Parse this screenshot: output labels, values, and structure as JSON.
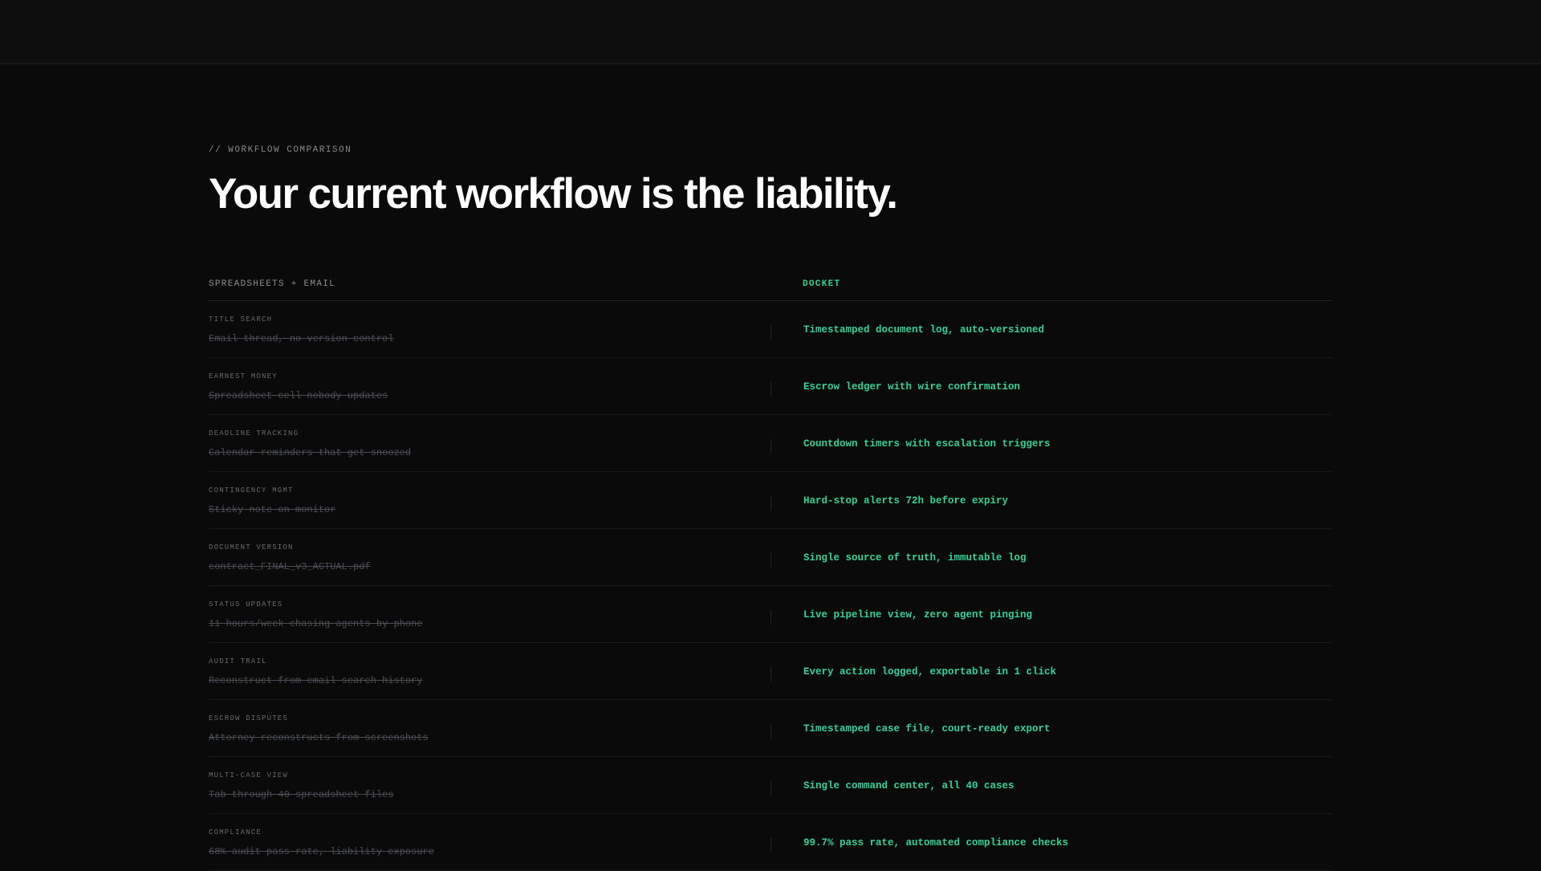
{
  "section": {
    "eyebrow": "// WORKFLOW COMPARISON",
    "headline": "Your current workflow is the liability."
  },
  "columns": {
    "left": "SPREADSHEETS + EMAIL",
    "right": "DOCKET"
  },
  "colors": {
    "background": "#0a0a0a",
    "accent": "#34d399",
    "muted": "#4a4e55"
  },
  "rows": [
    {
      "label": "TITLE SEARCH",
      "old": "Email thread, no version control",
      "new": "Timestamped document log, auto-versioned"
    },
    {
      "label": "EARNEST MONEY",
      "old": "Spreadsheet cell nobody updates",
      "new": "Escrow ledger with wire confirmation"
    },
    {
      "label": "DEADLINE TRACKING",
      "old": "Calendar reminders that get snoozed",
      "new": "Countdown timers with escalation triggers"
    },
    {
      "label": "CONTINGENCY MGMT",
      "old": "Sticky note on monitor",
      "new": "Hard-stop alerts 72h before expiry"
    },
    {
      "label": "DOCUMENT VERSION",
      "old": "contract_FINAL_v3_ACTUAL.pdf",
      "new": "Single source of truth, immutable log"
    },
    {
      "label": "STATUS UPDATES",
      "old": "11 hours/week chasing agents by phone",
      "new": "Live pipeline view, zero agent pinging"
    },
    {
      "label": "AUDIT TRAIL",
      "old": "Reconstruct from email search history",
      "new": "Every action logged, exportable in 1 click"
    },
    {
      "label": "ESCROW DISPUTES",
      "old": "Attorney reconstructs from screenshots",
      "new": "Timestamped case file, court-ready export"
    },
    {
      "label": "MULTI-CASE VIEW",
      "old": "Tab through 40 spreadsheet files",
      "new": "Single command center, all 40 cases"
    },
    {
      "label": "COMPLIANCE",
      "old": "68% audit pass rate, liability exposure",
      "new": "99.7% pass rate, automated compliance checks"
    }
  ]
}
